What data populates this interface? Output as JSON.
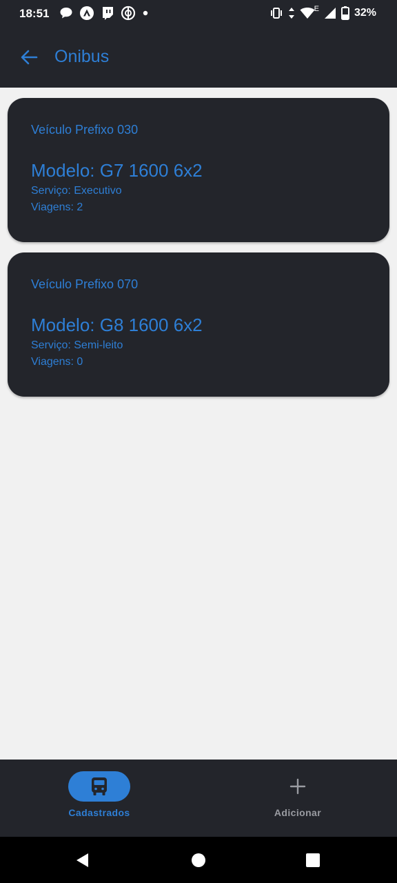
{
  "status_bar": {
    "time": "18:51",
    "battery": "32%",
    "left_icons": [
      "chat-bubble-icon",
      "nextdns-icon",
      "twitch-icon",
      "vpn-icon",
      "dot-icon"
    ],
    "right_icons": [
      "vibrate-icon",
      "data-arrows-icon",
      "wifi-icon",
      "signal-icon",
      "battery-icon"
    ],
    "network_type": "E"
  },
  "app_bar": {
    "title": "Onibus",
    "back_icon": "arrow-back-icon"
  },
  "vehicles": [
    {
      "prefix": "Veículo Prefixo 030",
      "model": "Modelo: G7 1600 6x2",
      "service": "Serviço: Executivo",
      "trips": "Viagens: 2"
    },
    {
      "prefix": "Veículo Prefixo 070",
      "model": "Modelo: G8 1600 6x2",
      "service": "Serviço: Semi-leito",
      "trips": "Viagens: 0"
    }
  ],
  "bottom_nav": {
    "items": [
      {
        "label": "Cadastrados",
        "icon": "bus-icon",
        "active": true
      },
      {
        "label": "Adicionar",
        "icon": "plus-icon",
        "active": false
      }
    ]
  },
  "colors": {
    "accent": "#2e7fd6",
    "surface": "#23252b",
    "background": "#f1f1f1"
  }
}
